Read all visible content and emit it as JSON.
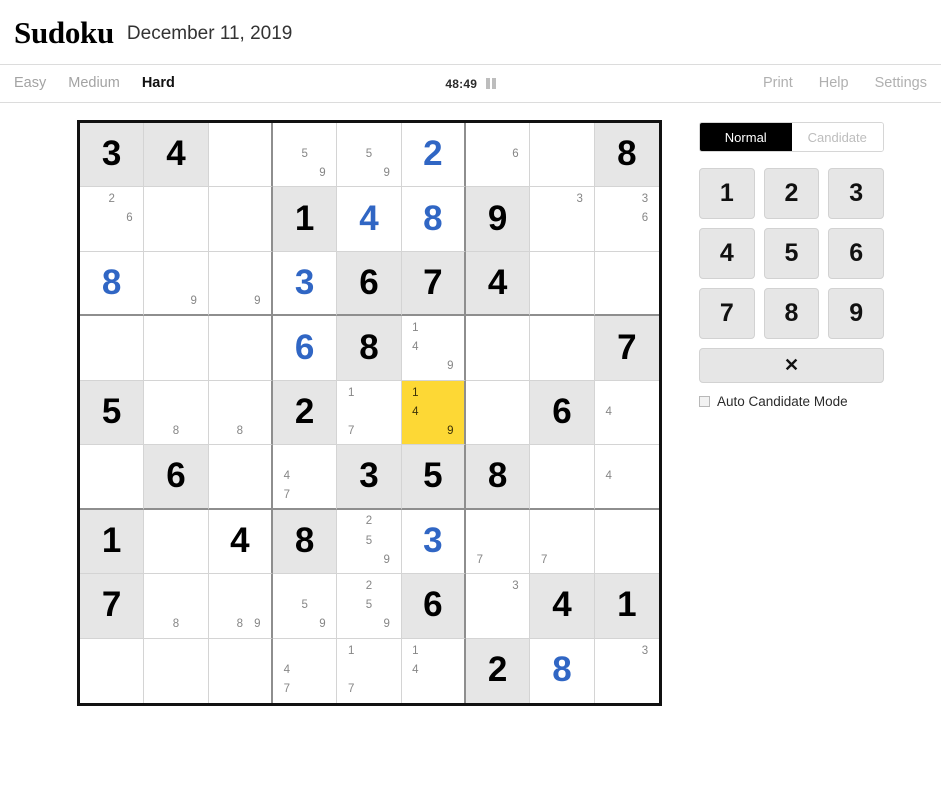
{
  "header": {
    "logo": "Sudoku",
    "date": "December 11, 2019"
  },
  "toolbar": {
    "difficulties": [
      {
        "label": "Easy",
        "active": false
      },
      {
        "label": "Medium",
        "active": false
      },
      {
        "label": "Hard",
        "active": true
      }
    ],
    "timer": "48:49",
    "pause_icon": "pause-icon",
    "links": [
      "Print",
      "Help",
      "Settings"
    ]
  },
  "panel": {
    "modes": [
      {
        "label": "Normal",
        "active": true
      },
      {
        "label": "Candidate",
        "active": false
      }
    ],
    "numbers": [
      "1",
      "2",
      "3",
      "4",
      "5",
      "6",
      "7",
      "8",
      "9"
    ],
    "erase_label": "✕",
    "auto_candidate_label": "Auto Candidate Mode",
    "auto_candidate_checked": false
  },
  "colors": {
    "given": "#000000",
    "user_entry": "#3066c4",
    "selected_cell": "#fdd835",
    "peer_shading": "#e6e6e6",
    "candidate_text": "#868686"
  },
  "board": {
    "selected": {
      "row": 5,
      "col": 6
    },
    "cells": [
      [
        {
          "value": "3",
          "type": "given",
          "shaded": true
        },
        {
          "value": "4",
          "type": "given",
          "shaded": true
        },
        {
          "value": "",
          "type": "empty",
          "shaded": false
        },
        {
          "value": "",
          "type": "candidates",
          "candidates": [
            5,
            9
          ],
          "shaded": false
        },
        {
          "value": "",
          "type": "candidates",
          "candidates": [
            5,
            9
          ],
          "shaded": false
        },
        {
          "value": "2",
          "type": "user",
          "shaded": false
        },
        {
          "value": "",
          "type": "candidates",
          "candidates": [
            6
          ],
          "shaded": false
        },
        {
          "value": "",
          "type": "empty",
          "shaded": false
        },
        {
          "value": "8",
          "type": "given",
          "shaded": true
        }
      ],
      [
        {
          "value": "",
          "type": "candidates",
          "candidates": [
            2,
            6
          ],
          "shaded": false
        },
        {
          "value": "",
          "type": "empty",
          "shaded": false
        },
        {
          "value": "",
          "type": "empty",
          "shaded": false
        },
        {
          "value": "1",
          "type": "given",
          "shaded": true
        },
        {
          "value": "4",
          "type": "user",
          "shaded": false
        },
        {
          "value": "8",
          "type": "user",
          "shaded": false
        },
        {
          "value": "9",
          "type": "given",
          "shaded": true
        },
        {
          "value": "",
          "type": "candidates",
          "candidates": [
            3
          ],
          "shaded": false
        },
        {
          "value": "",
          "type": "candidates",
          "candidates": [
            3,
            6
          ],
          "shaded": false
        }
      ],
      [
        {
          "value": "8",
          "type": "user",
          "shaded": false
        },
        {
          "value": "",
          "type": "candidates",
          "candidates": [
            9
          ],
          "shaded": false
        },
        {
          "value": "",
          "type": "candidates",
          "candidates": [
            9
          ],
          "shaded": false
        },
        {
          "value": "3",
          "type": "user",
          "shaded": false
        },
        {
          "value": "6",
          "type": "given",
          "shaded": true
        },
        {
          "value": "7",
          "type": "given",
          "shaded": true
        },
        {
          "value": "4",
          "type": "given",
          "shaded": true
        },
        {
          "value": "",
          "type": "empty",
          "shaded": false
        },
        {
          "value": "",
          "type": "empty",
          "shaded": false
        }
      ],
      [
        {
          "value": "",
          "type": "empty",
          "shaded": false
        },
        {
          "value": "",
          "type": "empty",
          "shaded": false
        },
        {
          "value": "",
          "type": "empty",
          "shaded": false
        },
        {
          "value": "6",
          "type": "user",
          "shaded": false
        },
        {
          "value": "8",
          "type": "given",
          "shaded": true
        },
        {
          "value": "",
          "type": "candidates",
          "candidates": [
            1,
            4,
            9
          ],
          "shaded": false
        },
        {
          "value": "",
          "type": "empty",
          "shaded": false
        },
        {
          "value": "",
          "type": "empty",
          "shaded": false
        },
        {
          "value": "7",
          "type": "given",
          "shaded": true
        }
      ],
      [
        {
          "value": "5",
          "type": "given",
          "shaded": true
        },
        {
          "value": "",
          "type": "candidates",
          "candidates": [
            8
          ],
          "shaded": false
        },
        {
          "value": "",
          "type": "candidates",
          "candidates": [
            8
          ],
          "shaded": false
        },
        {
          "value": "2",
          "type": "given",
          "shaded": true
        },
        {
          "value": "",
          "type": "candidates",
          "candidates": [
            1,
            7
          ],
          "shaded": false
        },
        {
          "value": "",
          "type": "candidates",
          "candidates": [
            1,
            4,
            9
          ],
          "shaded": false,
          "selected": true
        },
        {
          "value": "",
          "type": "empty",
          "shaded": false
        },
        {
          "value": "6",
          "type": "given",
          "shaded": true
        },
        {
          "value": "",
          "type": "candidates",
          "candidates": [
            4
          ],
          "shaded": false
        }
      ],
      [
        {
          "value": "",
          "type": "empty",
          "shaded": false
        },
        {
          "value": "6",
          "type": "given",
          "shaded": true
        },
        {
          "value": "",
          "type": "empty",
          "shaded": false
        },
        {
          "value": "",
          "type": "candidates",
          "candidates": [
            4,
            7
          ],
          "shaded": false
        },
        {
          "value": "3",
          "type": "given",
          "shaded": true
        },
        {
          "value": "5",
          "type": "given",
          "shaded": true
        },
        {
          "value": "8",
          "type": "given",
          "shaded": true
        },
        {
          "value": "",
          "type": "empty",
          "shaded": false
        },
        {
          "value": "",
          "type": "candidates",
          "candidates": [
            4
          ],
          "shaded": false
        }
      ],
      [
        {
          "value": "1",
          "type": "given",
          "shaded": true
        },
        {
          "value": "",
          "type": "empty",
          "shaded": false
        },
        {
          "value": "4",
          "type": "given",
          "shaded": false
        },
        {
          "value": "8",
          "type": "given",
          "shaded": true
        },
        {
          "value": "",
          "type": "candidates",
          "candidates": [
            2,
            5,
            9
          ],
          "shaded": false
        },
        {
          "value": "3",
          "type": "user",
          "shaded": false
        },
        {
          "value": "",
          "type": "candidates",
          "candidates": [
            7
          ],
          "shaded": false
        },
        {
          "value": "",
          "type": "candidates",
          "candidates": [
            7
          ],
          "shaded": false
        },
        {
          "value": "",
          "type": "empty",
          "shaded": false
        }
      ],
      [
        {
          "value": "7",
          "type": "given",
          "shaded": true
        },
        {
          "value": "",
          "type": "candidates",
          "candidates": [
            8
          ],
          "shaded": false
        },
        {
          "value": "",
          "type": "candidates",
          "candidates": [
            8,
            9
          ],
          "shaded": false
        },
        {
          "value": "",
          "type": "candidates",
          "candidates": [
            5,
            9
          ],
          "shaded": false
        },
        {
          "value": "",
          "type": "candidates",
          "candidates": [
            2,
            5,
            9
          ],
          "shaded": false
        },
        {
          "value": "6",
          "type": "given",
          "shaded": true
        },
        {
          "value": "",
          "type": "candidates",
          "candidates": [
            3
          ],
          "shaded": false
        },
        {
          "value": "4",
          "type": "given",
          "shaded": true
        },
        {
          "value": "1",
          "type": "given",
          "shaded": true
        }
      ],
      [
        {
          "value": "",
          "type": "empty",
          "shaded": false
        },
        {
          "value": "",
          "type": "empty",
          "shaded": false
        },
        {
          "value": "",
          "type": "empty",
          "shaded": false
        },
        {
          "value": "",
          "type": "candidates",
          "candidates": [
            4,
            7
          ],
          "shaded": false
        },
        {
          "value": "",
          "type": "candidates",
          "candidates": [
            1,
            7
          ],
          "shaded": false
        },
        {
          "value": "",
          "type": "candidates",
          "candidates": [
            1,
            4
          ],
          "shaded": false
        },
        {
          "value": "2",
          "type": "given",
          "shaded": true
        },
        {
          "value": "8",
          "type": "user",
          "shaded": false
        },
        {
          "value": "",
          "type": "candidates",
          "candidates": [
            3
          ],
          "shaded": false
        }
      ]
    ]
  }
}
